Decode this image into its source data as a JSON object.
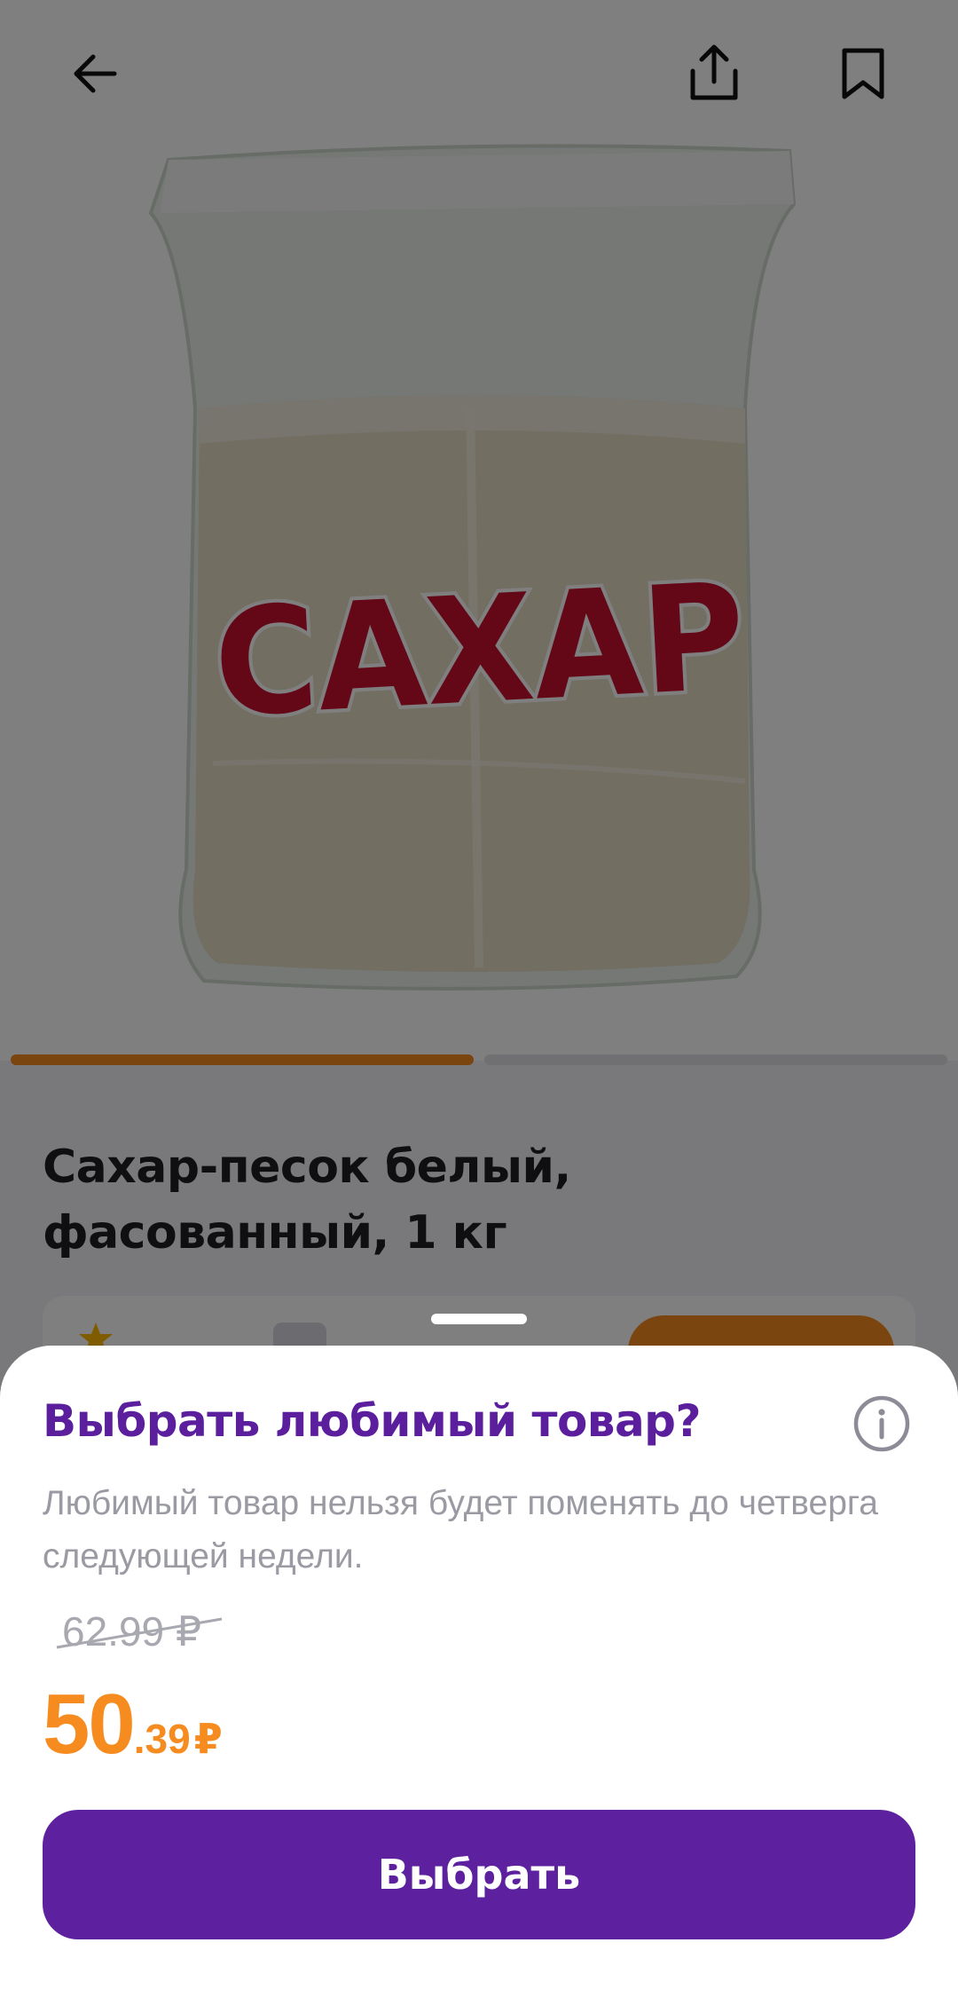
{
  "product": {
    "image_label": "САХАР",
    "title": "Сахар-песок белый, фасованный, 1 кг",
    "gallery": {
      "current_index": 1,
      "total": 2
    }
  },
  "sheet": {
    "title": "Выбрать любимый товар?",
    "description": "Любимый товар нельзя будет поменять до четверга следующей недели.",
    "old_price": "62.99 ₽",
    "new_price_int": "50",
    "new_price_frac": ".39",
    "currency": "₽",
    "choose_button": "Выбрать"
  },
  "icons": {
    "back": "arrow-left-icon",
    "share": "share-icon",
    "bookmark": "bookmark-icon",
    "info": "info-icon"
  },
  "colors": {
    "accent_orange": "#f68b1f",
    "brand_purple": "#5d219f",
    "title_purple": "#5b1f9e"
  }
}
